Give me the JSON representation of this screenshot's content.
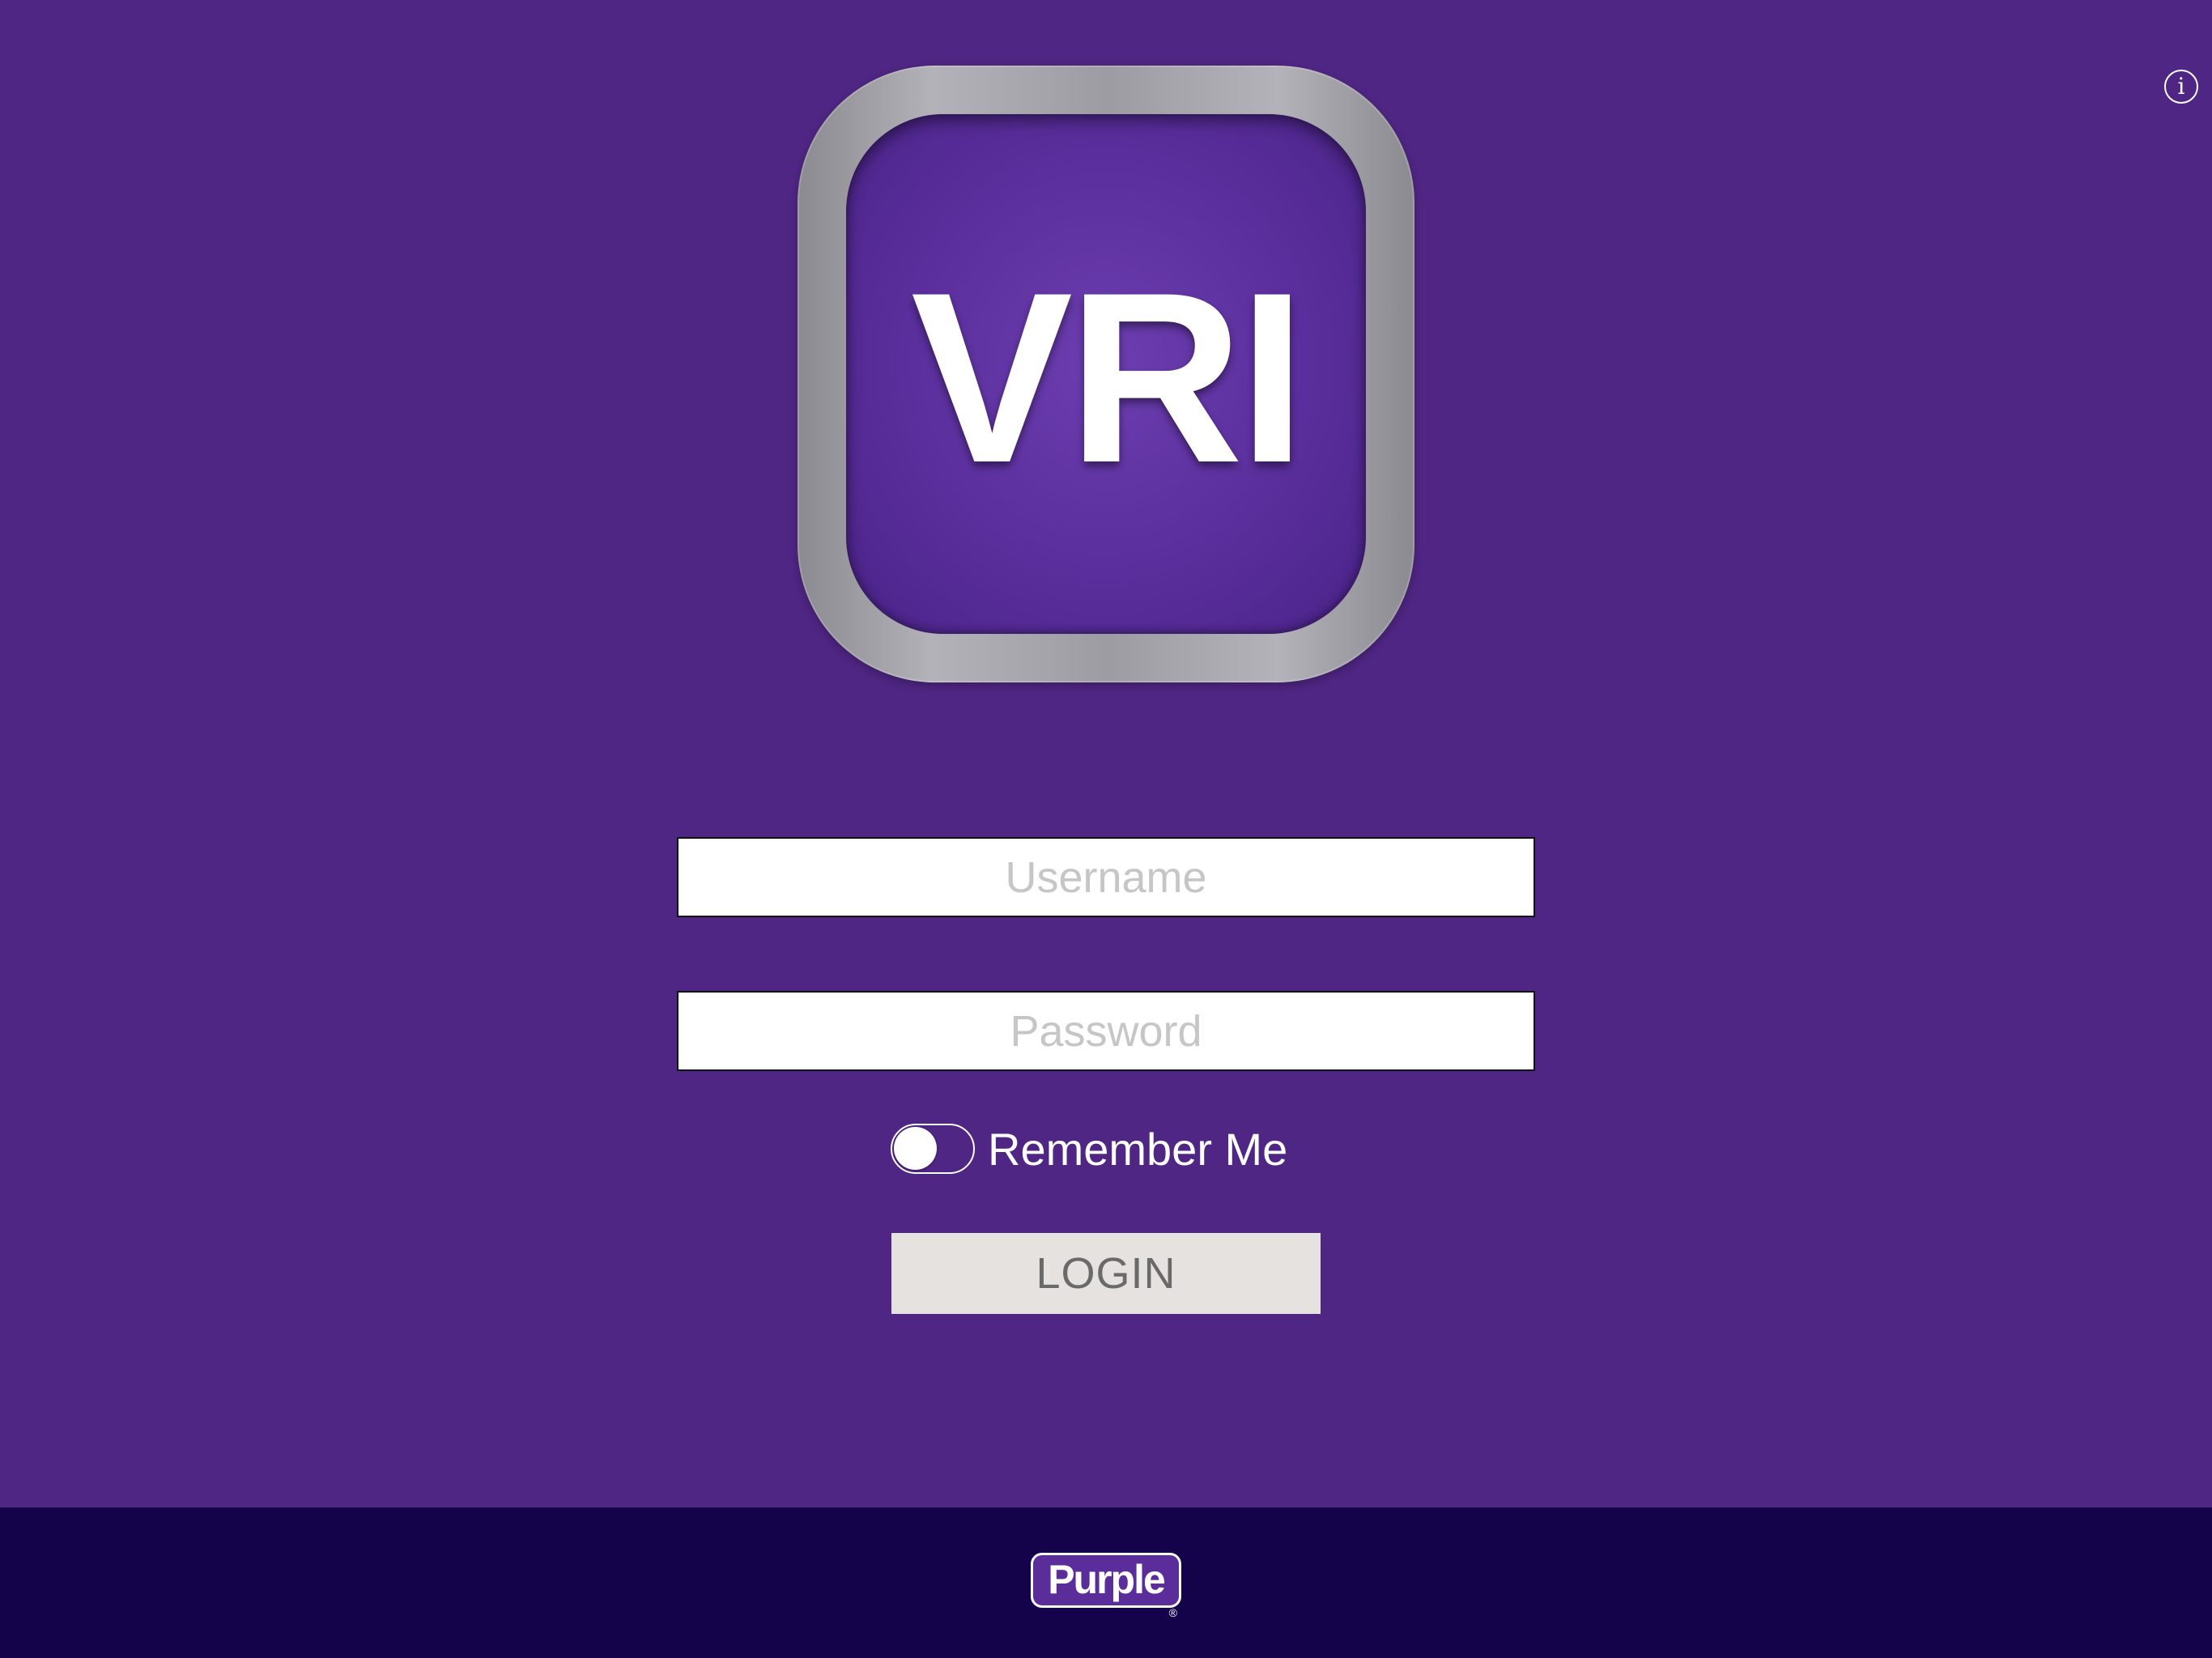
{
  "info": {
    "glyph": "i",
    "icon": "info-icon"
  },
  "logo": {
    "text": "VRI",
    "icon": "vri-app-icon"
  },
  "login_form": {
    "username_placeholder": "Username",
    "username_value": "",
    "password_placeholder": "Password",
    "password_value": "",
    "remember_label": "Remember Me",
    "remember_checked": false,
    "login_label": "LOGIN"
  },
  "footer": {
    "brand": "Purple",
    "reg_mark": "®"
  },
  "colors": {
    "background": "#4f2683",
    "footer": "#14024a",
    "login_button": "#e6e2e0"
  }
}
